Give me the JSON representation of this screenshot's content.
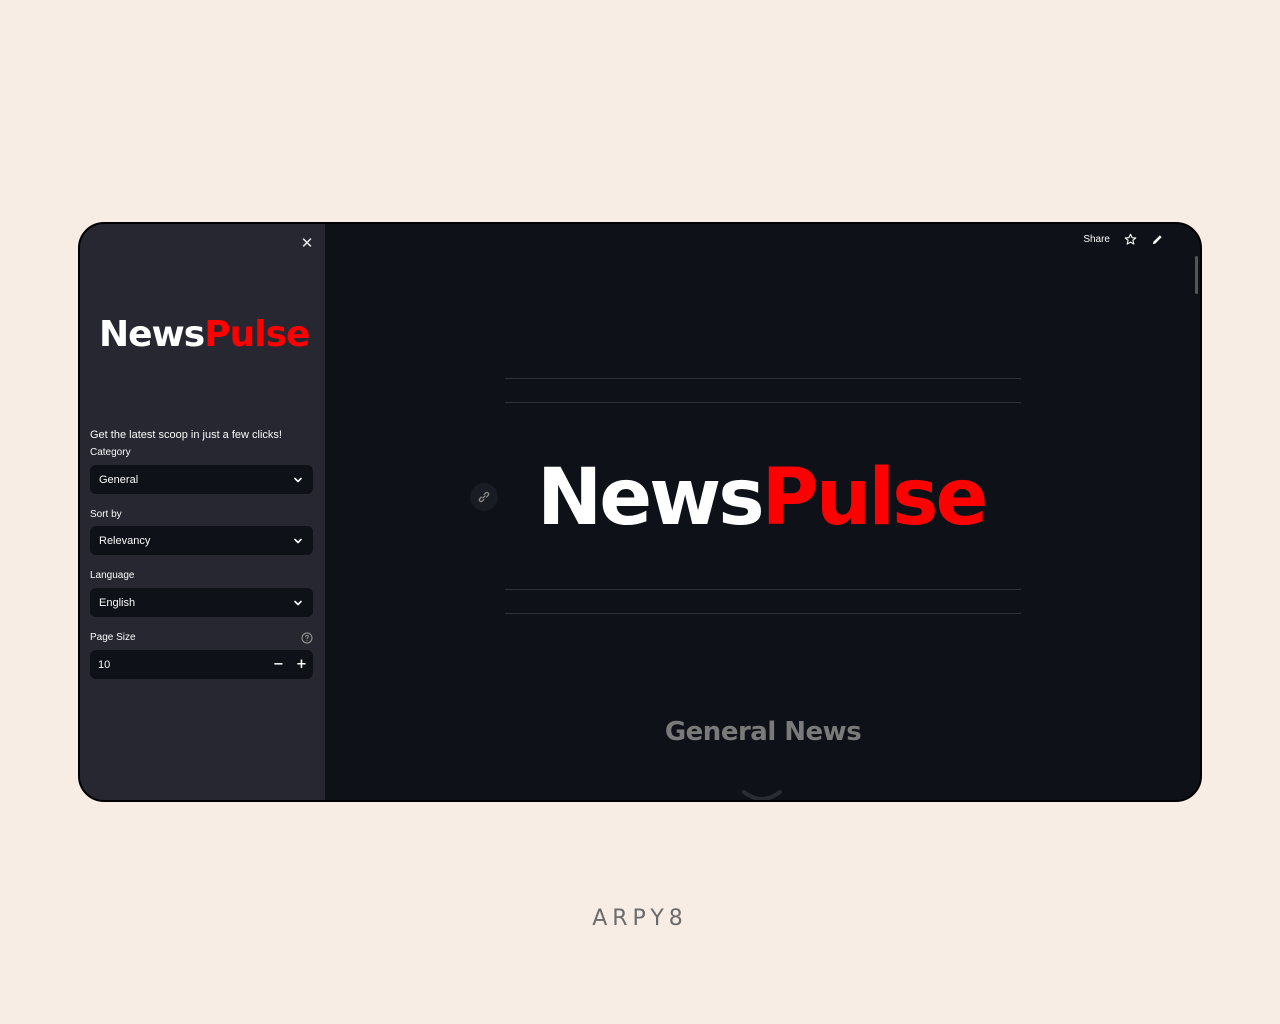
{
  "sidebar": {
    "logo": {
      "part1": "News",
      "part2": "Pulse"
    },
    "tagline": "Get the latest scoop in just a few clicks!",
    "category": {
      "label": "Category",
      "value": "General"
    },
    "sort_by": {
      "label": "Sort by",
      "value": "Relevancy"
    },
    "language": {
      "label": "Language",
      "value": "English"
    },
    "page_size": {
      "label": "Page Size",
      "value": "10",
      "minus": "−",
      "plus": "+"
    },
    "close_icon": "✕"
  },
  "toolbar": {
    "share_label": "Share",
    "icons": [
      "star-icon",
      "edit-pencil-icon"
    ]
  },
  "main": {
    "logo": {
      "part1": "News",
      "part2": "Pulse"
    },
    "section_title": "General News"
  },
  "brand": "ARPY8",
  "colors": {
    "accent_red": "#ff0000",
    "sidebar_bg": "#262730",
    "main_bg": "#0e1117",
    "page_bg": "#f8ede4"
  }
}
